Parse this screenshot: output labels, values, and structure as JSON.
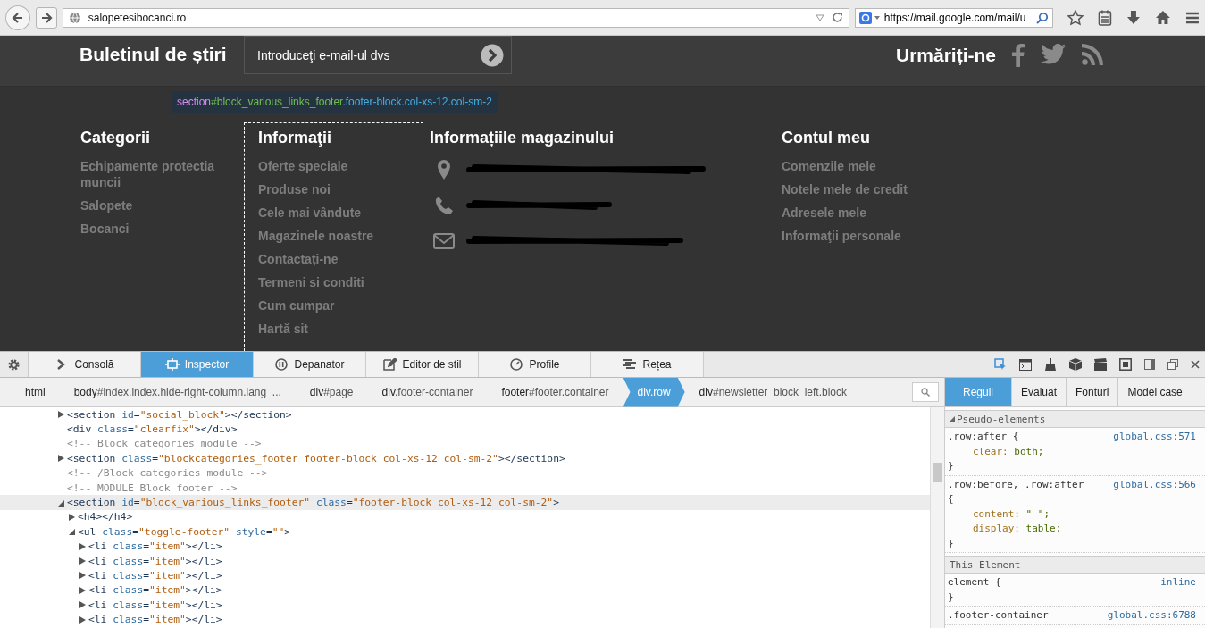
{
  "browser": {
    "url": "salopetesibocanci.ro",
    "search_text": "https://mail.google.com/mail/u"
  },
  "newsletter": {
    "title": "Buletinul de știri",
    "placeholder": "Introduceţi e-mail-ul dvs"
  },
  "follow": {
    "title": "Urmăriți-ne"
  },
  "tooltip": {
    "tag": "section",
    "id": "#block_various_links_footer",
    "classes": ".footer-block.col-xs-12.col-sm-2"
  },
  "footer": {
    "columns": [
      {
        "title": "Categorii",
        "highlighted": false,
        "links": [
          "Echipamente protectia muncii",
          "Salopete",
          "Bocanci"
        ]
      },
      {
        "title": "Informaţii",
        "highlighted": true,
        "links": [
          "Oferte speciale",
          "Produse noi",
          "Cele mai vândute",
          "Magazinele noastre",
          "Contactați-ne",
          "Termeni si conditi",
          "Cum cumpar",
          "Hartă sit"
        ]
      },
      {
        "title": "Contul meu",
        "highlighted": false,
        "links": [
          "Comenzile mele",
          "Notele mele de credit",
          "Adresele mele",
          "Informaţii personale"
        ]
      }
    ],
    "store": {
      "title": "Informațiile magazinului",
      "rows": [
        {
          "kind": "pin"
        },
        {
          "kind": "phone"
        },
        {
          "kind": "mail"
        }
      ]
    }
  },
  "devtools": {
    "tabs": [
      {
        "label": "Consolă",
        "selected": false
      },
      {
        "label": "Inspector",
        "selected": true
      },
      {
        "label": "Depanator",
        "selected": false
      },
      {
        "label": "Editor de stil",
        "selected": false
      },
      {
        "label": "Profile",
        "selected": false
      },
      {
        "label": "Rețea",
        "selected": false
      }
    ],
    "breadcrumbs": [
      {
        "tag": "html",
        "selected": false
      },
      {
        "tag": "body",
        "rest": "#index.index.hide-right-column.lang_...",
        "selected": false
      },
      {
        "tag": "div",
        "rest": "#page",
        "selected": false
      },
      {
        "tag": "div",
        "rest": ".footer-container",
        "selected": false
      },
      {
        "tag": "footer",
        "rest": "#footer.container",
        "selected": false
      },
      {
        "tag": "div.row",
        "selected": true
      },
      {
        "tag": "div",
        "rest": "#newsletter_block_left.block",
        "selected": false
      }
    ],
    "markup": [
      {
        "kind": "node",
        "text": "<section id=\"social_block\"></section>",
        "expanded": false,
        "selected": false
      },
      {
        "kind": "leaf",
        "text": "<div class=\"clearfix\"></div>",
        "selected": false
      },
      {
        "kind": "comment",
        "text": "<!-- Block categories module -->",
        "selected": false
      },
      {
        "kind": "node",
        "text": "<section class=\"blockcategories_footer footer-block col-xs-12 col-sm-2\"></section>",
        "expanded": false,
        "selected": false
      },
      {
        "kind": "comment",
        "text": "<!-- /Block categories module -->",
        "selected": false
      },
      {
        "kind": "comment",
        "text": "<!-- MODULE Block footer -->",
        "selected": false
      },
      {
        "kind": "node",
        "text": "<section id=\"block_various_links_footer\" class=\"footer-block col-xs-12 col-sm-2\">",
        "expanded": true,
        "selected": true,
        "children": [
          {
            "kind": "node",
            "text": "<h4></h4>",
            "expanded": false,
            "selected": false
          },
          {
            "kind": "node",
            "text": "<ul class=\"toggle-footer\" style=\"\">",
            "expanded": true,
            "selected": false,
            "children": [
              {
                "kind": "node",
                "text": "<li class=\"item\"></li>",
                "expanded": false,
                "selected": false
              },
              {
                "kind": "node",
                "text": "<li class=\"item\"></li>",
                "expanded": false,
                "selected": false
              },
              {
                "kind": "node",
                "text": "<li class=\"item\"></li>",
                "expanded": false,
                "selected": false
              },
              {
                "kind": "node",
                "text": "<li class=\"item\"></li>",
                "expanded": false,
                "selected": false
              },
              {
                "kind": "node",
                "text": "<li class=\"item\"></li>",
                "expanded": false,
                "selected": false
              },
              {
                "kind": "node",
                "text": "<li class=\"item\"></li>",
                "expanded": false,
                "selected": false
              }
            ]
          }
        ]
      }
    ],
    "side_tabs": [
      {
        "label": "Reguli",
        "selected": true
      },
      {
        "label": "Evaluat",
        "selected": false
      },
      {
        "label": "Fonturi",
        "selected": false
      },
      {
        "label": "Model case",
        "selected": false
      }
    ],
    "sections": [
      {
        "title": "Pseudo-elements",
        "expanded": true,
        "rules": [
          {
            "selector_lines": [
              ".row:after {"
            ],
            "source": "global.css:571",
            "decls": [
              "clear: both;"
            ],
            "close": "}"
          },
          {
            "selector_lines": [
              ".row:before, .row:after",
              "{"
            ],
            "source": "global.css:566",
            "decls": [
              "content: \" \";",
              "display: table;"
            ],
            "close": "}"
          }
        ]
      },
      {
        "title": "This Element",
        "rules": [
          {
            "selector_lines": [
              "element {"
            ],
            "source": "inline",
            "close": "}"
          },
          {
            "selector_lines": [
              ".footer-container"
            ],
            "source": "global.css:6788"
          }
        ]
      }
    ]
  }
}
